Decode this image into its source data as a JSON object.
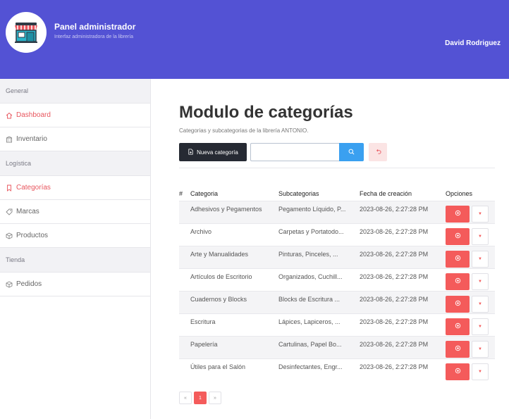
{
  "colors": {
    "header": "#5352d4",
    "accent": "#f45b5b",
    "dark_button": "#262a33",
    "search_button": "#3aa0f0"
  },
  "header": {
    "title": "Panel administrador",
    "subtitle": "Interfaz administradora de la librería",
    "user": "David Rodriguez",
    "logo_icon": "storefront-icon"
  },
  "sidebar": {
    "sections": [
      {
        "label": "General",
        "items": [
          {
            "label": "Dashboard",
            "icon": "home-icon",
            "active": false
          },
          {
            "label": "Inventario",
            "icon": "building-icon",
            "active": false
          }
        ]
      },
      {
        "label": "Logística",
        "items": [
          {
            "label": "Categorías",
            "icon": "bookmark-icon",
            "active": true
          },
          {
            "label": "Marcas",
            "icon": "tag-icon",
            "active": false
          },
          {
            "label": "Productos",
            "icon": "box-icon",
            "active": false
          }
        ]
      },
      {
        "label": "Tienda",
        "items": [
          {
            "label": "Pedidos",
            "icon": "box-icon",
            "active": false
          }
        ]
      }
    ]
  },
  "main": {
    "title": "Modulo de categorías",
    "subtitle": "Categorias y subcategorias de la librería ANTONIO.",
    "new_button": "Nueva categoría",
    "search_placeholder": "",
    "table": {
      "headers": [
        "#",
        "Categoria",
        "Subcategorias",
        "Fecha de creación",
        "Opciones"
      ],
      "rows": [
        {
          "category": "Adhesivos y Pegamentos",
          "subcategories": "Pegamento Líquido, P...",
          "date": "2023-08-26, 2:27:28 PM"
        },
        {
          "category": "Archivo",
          "subcategories": "Carpetas y Portatodo...",
          "date": "2023-08-26, 2:27:28 PM"
        },
        {
          "category": "Arte y Manualidades",
          "subcategories": "Pinturas, Pinceles, ...",
          "date": "2023-08-26, 2:27:28 PM"
        },
        {
          "category": "Artículos de Escritorio",
          "subcategories": "Organizados, Cuchill...",
          "date": "2023-08-26, 2:27:28 PM"
        },
        {
          "category": "Cuadernos y Blocks",
          "subcategories": "Blocks de Escritura ...",
          "date": "2023-08-26, 2:27:28 PM"
        },
        {
          "category": "Escritura",
          "subcategories": "Lápices, Lapiceros, ...",
          "date": "2023-08-26, 2:27:28 PM"
        },
        {
          "category": "Papelería",
          "subcategories": "Cartulinas, Papel Bo...",
          "date": "2023-08-26, 2:27:28 PM"
        },
        {
          "category": "Útiles para el Salón",
          "subcategories": "Desinfectantes, Engr...",
          "date": "2023-08-26, 2:27:28 PM"
        }
      ]
    },
    "pagination": {
      "prev": "«",
      "current": "1",
      "next": "»"
    }
  }
}
